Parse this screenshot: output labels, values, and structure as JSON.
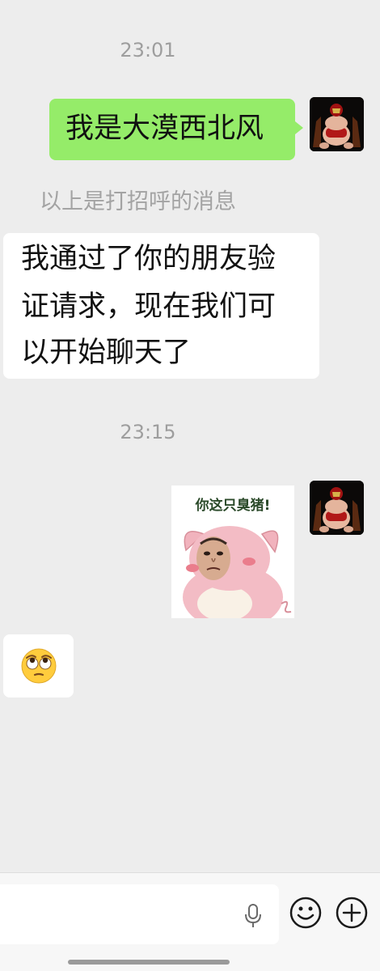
{
  "conversation": {
    "timestamp_1": "23:01",
    "my_message": "我是大漠西北风",
    "system_notice": "以上是打招呼的消息",
    "their_message_lines": [
      "我通过了你的朋友验",
      "证请求，现在我们可",
      "以开始聊天了"
    ],
    "timestamp_2": "23:15",
    "sticker_caption": "你这只臭猪!",
    "their_emoji": "🙄"
  },
  "input_bar": {
    "input_value": "",
    "icons": [
      "microphone-icon",
      "emoji-icon",
      "plus-icon"
    ]
  },
  "colors": {
    "background": "#ededed",
    "my_bubble": "#95ec69",
    "their_bubble": "#ffffff",
    "timestamp_text": "#9e9e9e"
  }
}
